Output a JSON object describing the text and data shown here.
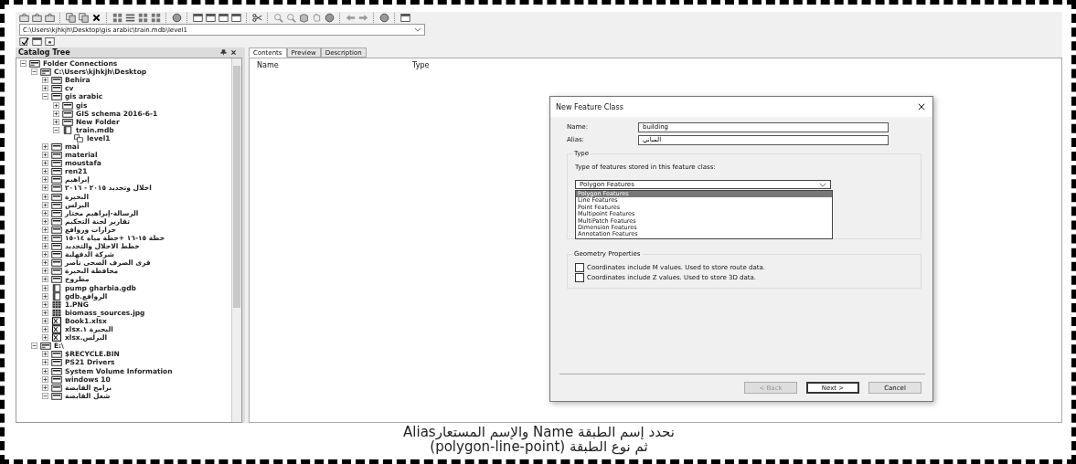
{
  "toolbar": {
    "address": "C:\\Users\\kjhkjh\\Desktop\\gis arabic\\train.mdb\\level1"
  },
  "catalog_tree": {
    "title": "Catalog Tree",
    "items": [
      {
        "label": "Folder Connections",
        "kind": "connections",
        "expanded": true,
        "children": [
          {
            "label": "C:\\Users\\kjhkjh\\Desktop",
            "kind": "drive",
            "expanded": true,
            "children": [
              {
                "label": "Behira",
                "kind": "folder",
                "expanded": false
              },
              {
                "label": "cv",
                "kind": "folder",
                "expanded": false
              },
              {
                "label": "gis arabic",
                "kind": "folder",
                "expanded": true,
                "children": [
                  {
                    "label": "gis",
                    "kind": "folder",
                    "expanded": false
                  },
                  {
                    "label": "GIS schema 2016-6-1",
                    "kind": "folder",
                    "expanded": false
                  },
                  {
                    "label": "New Folder",
                    "kind": "folder",
                    "expanded": false
                  },
                  {
                    "label": "train.mdb",
                    "kind": "database",
                    "expanded": true,
                    "children": [
                      {
                        "label": "level1",
                        "kind": "dataset"
                      }
                    ]
                  }
                ]
              },
              {
                "label": "mai",
                "kind": "folder",
                "expanded": false
              },
              {
                "label": "material",
                "kind": "folder",
                "expanded": false
              },
              {
                "label": "moustafa",
                "kind": "folder",
                "expanded": false
              },
              {
                "label": "ren21",
                "kind": "folder",
                "expanded": false
              },
              {
                "label": "إبراهيم",
                "kind": "folder",
                "expanded": false
              },
              {
                "label": "احلال وتجديد ٢٠١٥ - ٢٠١٦",
                "kind": "folder",
                "expanded": false
              },
              {
                "label": "البحيرة",
                "kind": "folder",
                "expanded": false
              },
              {
                "label": "البرلس",
                "kind": "folder",
                "expanded": false
              },
              {
                "label": "الرسالة-إبراهيم مختار",
                "kind": "folder",
                "expanded": false
              },
              {
                "label": "تقارير لجنة التحكيم",
                "kind": "folder",
                "expanded": false
              },
              {
                "label": "حرارات وروافع",
                "kind": "folder",
                "expanded": false
              },
              {
                "label": "خطة ١٥-١٦ +خطة مياه ١٤-١٥",
                "kind": "folder",
                "expanded": false
              },
              {
                "label": "خطط الاحلال والتجديد",
                "kind": "folder",
                "expanded": false
              },
              {
                "label": "شركة الدقهلية",
                "kind": "folder",
                "expanded": false
              },
              {
                "label": "قرى الصرف الصحى ناصر",
                "kind": "folder",
                "expanded": false
              },
              {
                "label": "محافظة البحيرة",
                "kind": "folder",
                "expanded": false
              },
              {
                "label": "مطروح",
                "kind": "folder",
                "expanded": false
              },
              {
                "label": "pump gharbia.gdb",
                "kind": "database",
                "expanded": false
              },
              {
                "label": "الروافع.gdb",
                "kind": "database",
                "expanded": false
              },
              {
                "label": "1.PNG",
                "kind": "raster",
                "expanded": false
              },
              {
                "label": "biomass_sources.jpg",
                "kind": "raster",
                "expanded": false
              },
              {
                "label": "Book1.xlsx",
                "kind": "spreadsheet",
                "expanded": false
              },
              {
                "label": "البحيرة ١.xlsx",
                "kind": "spreadsheet",
                "expanded": false
              },
              {
                "label": "البرلس.xlsx",
                "kind": "spreadsheet",
                "expanded": false
              }
            ]
          },
          {
            "label": "E:\\",
            "kind": "drive",
            "expanded": true,
            "children": [
              {
                "label": "$RECYCLE.BIN",
                "kind": "folder",
                "expanded": false
              },
              {
                "label": "PS21 Drivers",
                "kind": "folder",
                "expanded": false
              },
              {
                "label": "System Volume Information",
                "kind": "folder",
                "expanded": false
              },
              {
                "label": "windows 10",
                "kind": "folder",
                "expanded": false
              },
              {
                "label": "برامج القابضة",
                "kind": "folder",
                "expanded": false
              },
              {
                "label": "شغل القابضة",
                "kind": "folder",
                "expanded": true
              }
            ]
          }
        ]
      }
    ]
  },
  "tabs": [
    {
      "label": "Contents",
      "selected": true
    },
    {
      "label": "Preview",
      "selected": false
    },
    {
      "label": "Description",
      "selected": false
    }
  ],
  "columns": [
    "Name",
    "Type"
  ],
  "dialog": {
    "title": "New Feature Class",
    "name_label": "Name:",
    "name_value": "building",
    "alias_label": "Alias:",
    "alias_value": "المباني",
    "type_group": "Type",
    "type_prompt": "Type of features stored in this feature class:",
    "type_value": "Polygon Features",
    "type_options": [
      {
        "label": "Polygon Features",
        "selected": true
      },
      {
        "label": "Line Features",
        "selected": false
      },
      {
        "label": "Point Features",
        "selected": false
      },
      {
        "label": "Multipoint Features",
        "selected": false
      },
      {
        "label": "MultiPatch Features",
        "selected": false
      },
      {
        "label": "Dimension Features",
        "selected": false
      },
      {
        "label": "Annotation Features",
        "selected": false
      }
    ],
    "geometry_group": "Geometry Properties",
    "checkboxes": [
      {
        "label": "Coordinates include M values. Used to store route data.",
        "checked": false
      },
      {
        "label": "Coordinates include Z values. Used to store 3D data.",
        "checked": false
      }
    ],
    "buttons": [
      {
        "label": "< Back",
        "disabled": true,
        "default": false
      },
      {
        "label": "Next >",
        "disabled": false,
        "default": true
      },
      {
        "label": "Cancel",
        "disabled": false,
        "default": false
      }
    ]
  },
  "caption": [
    "نحدد إسم الطبقة Name والإسم المستعارAlias",
    "ثم نوع الطبقة (polygon-line-point)"
  ]
}
